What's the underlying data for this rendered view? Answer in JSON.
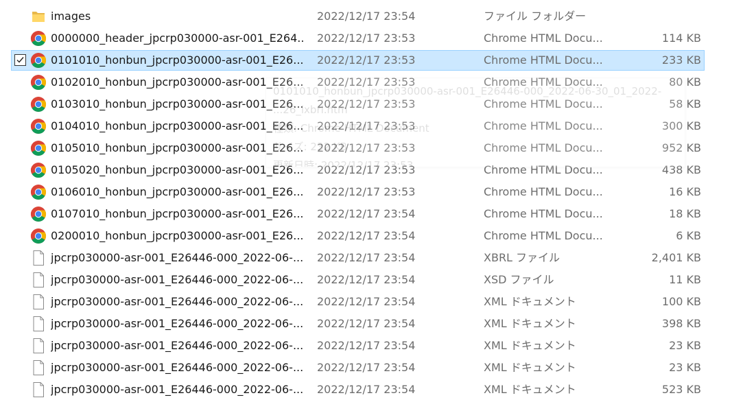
{
  "theme": {
    "selected_bg": "#cce8ff",
    "selected_border": "#99d1ff",
    "secondary_text": "#6d6d6d"
  },
  "files": [
    {
      "name": "images",
      "date": "2022/12/17 23:54",
      "type": "ファイル フォルダー",
      "size": "",
      "icon": "folder-icon",
      "selected": false
    },
    {
      "name": "0000000_header_jpcrp030000-asr-001_E264...",
      "date": "2022/12/17 23:53",
      "type": "Chrome HTML Docu...",
      "size": "114 KB",
      "icon": "chrome-icon",
      "selected": false
    },
    {
      "name": "0101010_honbun_jpcrp030000-asr-001_E26...",
      "date": "2022/12/17 23:53",
      "type": "Chrome HTML Docu...",
      "size": "233 KB",
      "icon": "chrome-icon",
      "selected": true
    },
    {
      "name": "0102010_honbun_jpcrp030000-asr-001_E26...",
      "date": "2022/12/17 23:53",
      "type": "Chrome HTML Docu...",
      "size": "80 KB",
      "icon": "chrome-icon",
      "selected": false
    },
    {
      "name": "0103010_honbun_jpcrp030000-asr-001_E26...",
      "date": "2022/12/17 23:53",
      "type": "Chrome HTML Docu...",
      "size": "58 KB",
      "icon": "chrome-icon",
      "selected": false
    },
    {
      "name": "0104010_honbun_jpcrp030000-asr-001_E26...",
      "date": "2022/12/17 23:53",
      "type": "Chrome HTML Docu...",
      "size": "300 KB",
      "icon": "chrome-icon",
      "selected": false
    },
    {
      "name": "0105010_honbun_jpcrp030000-asr-001_E26...",
      "date": "2022/12/17 23:53",
      "type": "Chrome HTML Docu...",
      "size": "952 KB",
      "icon": "chrome-icon",
      "selected": false
    },
    {
      "name": "0105020_honbun_jpcrp030000-asr-001_E26...",
      "date": "2022/12/17 23:53",
      "type": "Chrome HTML Docu...",
      "size": "438 KB",
      "icon": "chrome-icon",
      "selected": false
    },
    {
      "name": "0106010_honbun_jpcrp030000-asr-001_E26...",
      "date": "2022/12/17 23:53",
      "type": "Chrome HTML Docu...",
      "size": "16 KB",
      "icon": "chrome-icon",
      "selected": false
    },
    {
      "name": "0107010_honbun_jpcrp030000-asr-001_E26...",
      "date": "2022/12/17 23:54",
      "type": "Chrome HTML Docu...",
      "size": "18 KB",
      "icon": "chrome-icon",
      "selected": false
    },
    {
      "name": "0200010_honbun_jpcrp030000-asr-001_E26...",
      "date": "2022/12/17 23:54",
      "type": "Chrome HTML Docu...",
      "size": "6 KB",
      "icon": "chrome-icon",
      "selected": false
    },
    {
      "name": "jpcrp030000-asr-001_E26446-000_2022-06-...",
      "date": "2022/12/17 23:54",
      "type": "XBRL ファイル",
      "size": "2,401 KB",
      "icon": "file-icon",
      "selected": false
    },
    {
      "name": "jpcrp030000-asr-001_E26446-000_2022-06-...",
      "date": "2022/12/17 23:54",
      "type": "XSD ファイル",
      "size": "11 KB",
      "icon": "file-icon",
      "selected": false
    },
    {
      "name": "jpcrp030000-asr-001_E26446-000_2022-06-...",
      "date": "2022/12/17 23:54",
      "type": "XML ドキュメント",
      "size": "100 KB",
      "icon": "file-icon",
      "selected": false
    },
    {
      "name": "jpcrp030000-asr-001_E26446-000_2022-06-...",
      "date": "2022/12/17 23:54",
      "type": "XML ドキュメント",
      "size": "398 KB",
      "icon": "file-icon",
      "selected": false
    },
    {
      "name": "jpcrp030000-asr-001_E26446-000_2022-06-...",
      "date": "2022/12/17 23:54",
      "type": "XML ドキュメント",
      "size": "23 KB",
      "icon": "file-icon",
      "selected": false
    },
    {
      "name": "jpcrp030000-asr-001_E26446-000_2022-06-...",
      "date": "2022/12/17 23:54",
      "type": "XML ドキュメント",
      "size": "23 KB",
      "icon": "file-icon",
      "selected": false
    },
    {
      "name": "jpcrp030000-asr-001_E26446-000_2022-06-...",
      "date": "2022/12/17 23:54",
      "type": "XML ドキュメント",
      "size": "523 KB",
      "icon": "file-icon",
      "selected": false
    }
  ],
  "tooltip": {
    "line1": "0101010_honbun_jpcrp030000-asr-001_E26446-000_2022-06-30_01_2022-",
    "line2": "...26_ixbrl.htm",
    "line3": "種類: Chrome HTML Document",
    "line4": "サイズ: 232 KB",
    "line5": "更新日時: 2022/12/17 23:53"
  }
}
